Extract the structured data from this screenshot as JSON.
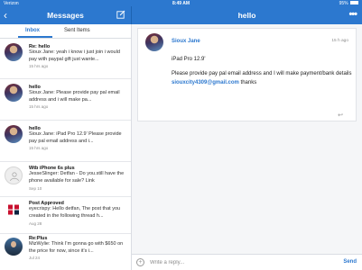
{
  "status": {
    "carrier": "Verizon",
    "time": "8:49 AM",
    "battery": "95%"
  },
  "left_nav": {
    "title": "Messages",
    "back": "‹",
    "compose_icon": "compose-icon"
  },
  "right_nav": {
    "title": "hello",
    "more": "•••"
  },
  "tabs": {
    "inbox": "Inbox",
    "sent": "Sent Items"
  },
  "conversations": [
    {
      "subject": "Re: hello",
      "snippet": "Sioux Jane: yeah i know i just join i would pay with paypal gift just wante...",
      "time": "15 hrs ago",
      "avatar": "photo"
    },
    {
      "subject": "hello",
      "snippet": "Sioux Jane: Please provide pay pal email address and i will make pa...",
      "time": "15 hrs ago",
      "avatar": "photo"
    },
    {
      "subject": "hello",
      "snippet": "Sioux Jane: iPad Pro 12.9' Please provide pay pal email address and i...",
      "time": "15 hrs ago",
      "avatar": "photo"
    },
    {
      "subject": "Wtb iPhone 6s plus",
      "snippet": "JesseSlinger: Detfan - Do you.still have the phone available for sale? Link",
      "time": "Sep 10",
      "avatar": "generic"
    },
    {
      "subject": "Post Approved",
      "snippet": "eyecrispy: Hello detfan, The post that you created in the following thread h...",
      "time": "Aug 28",
      "avatar": "logo"
    },
    {
      "subject": "Re:Plus",
      "snippet": "MizWylie: Think I'm gonna go with $650 on the price for now, since it's i...",
      "time": "Jul 24",
      "avatar": "person"
    }
  ],
  "message": {
    "sender": "Sioux Jane",
    "time": "15 h ago",
    "line1": "iPad Pro 12.9'",
    "line2_pre": "Please provide pay pal email address and I will make payment/bank details ",
    "email": "siouxcity4309@gmail.com",
    "line2_post": " thanks",
    "reply_icon": "↩"
  },
  "reply": {
    "plus": "+",
    "placeholder": "Write a reply...",
    "send": "Send"
  },
  "colors": {
    "accent": "#2c78cf",
    "background": "#f5f6f8"
  }
}
